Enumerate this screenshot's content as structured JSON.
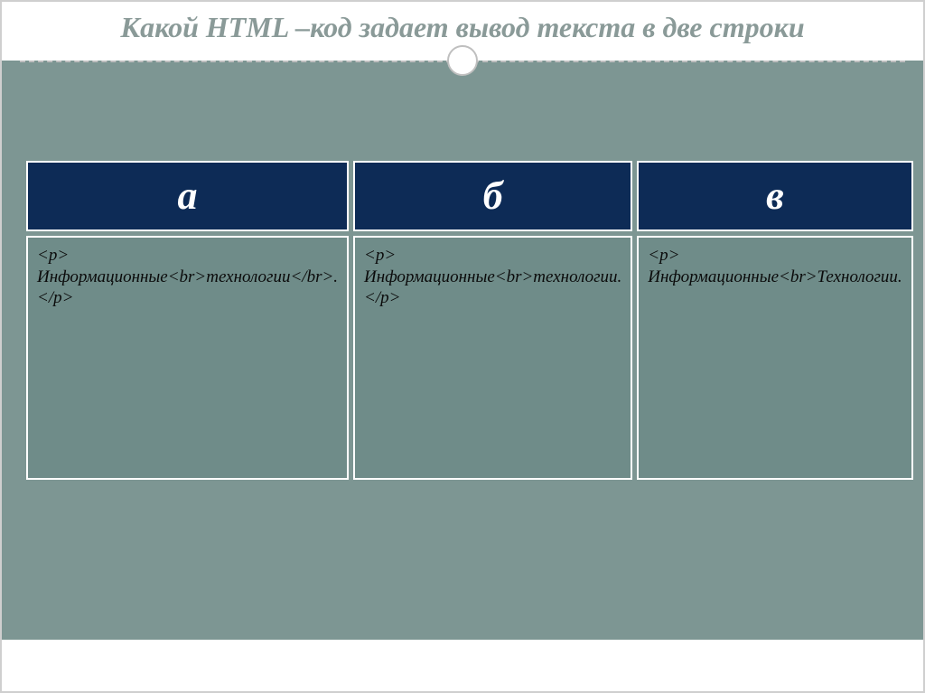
{
  "title": "Какой HTML –код задает вывод текста в две строки",
  "options": {
    "headers": [
      "а",
      "б",
      "в"
    ],
    "cells": [
      "<p>\nИнформационные<br>технологии</br>.\n</p>",
      "<p>\nИнформационные<br>технологии.\n</p>",
      "<p>\nИнформационные<br>Технологии."
    ]
  }
}
